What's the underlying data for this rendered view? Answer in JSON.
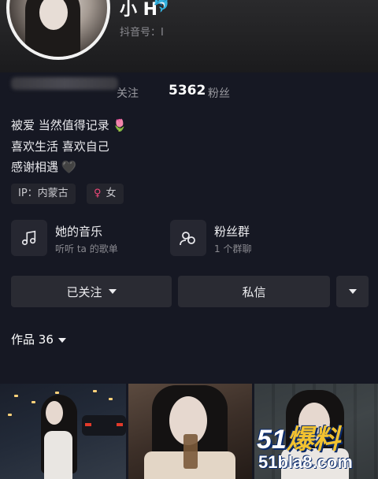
{
  "profile": {
    "nickname": "小 H",
    "nickname_icon": "dolphin-icon",
    "douyin_id_label": "抖音号：I",
    "stats": {
      "following_label": "关注",
      "followers_count": "5362",
      "followers_label": "粉丝"
    },
    "bio": [
      {
        "text": "被爱 当然值得记录",
        "emoji": "🌷"
      },
      {
        "text": "喜欢生活 喜欢自己",
        "emoji": ""
      },
      {
        "text": "感谢相遇",
        "emoji": "🖤"
      }
    ],
    "tags": {
      "ip": "IP：内蒙古",
      "gender_symbol": "♀",
      "gender": "女"
    }
  },
  "entries": {
    "music": {
      "title": "她的音乐",
      "subtitle": "听听 ta 的歌单",
      "icon": "music-note-icon"
    },
    "fans_group": {
      "title": "粉丝群",
      "subtitle": "1 个群聊",
      "icon": "group-icon"
    }
  },
  "actions": {
    "follow_label": "已关注",
    "message_label": "私信"
  },
  "works": {
    "label": "作品",
    "count": "36"
  },
  "watermark": {
    "top": "51",
    "top_highlight": "爆料",
    "bottom": "51bla8.com"
  },
  "colors": {
    "background": "#161823",
    "button": "#2a2b33",
    "accent_pink": "#f0487a"
  }
}
